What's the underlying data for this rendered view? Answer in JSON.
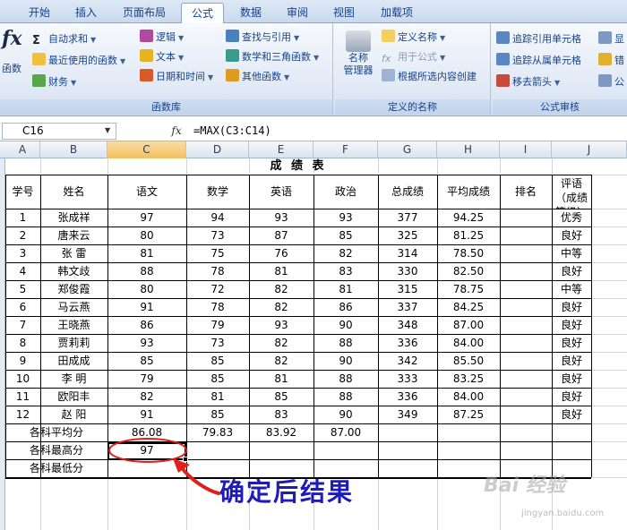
{
  "ribbon": {
    "tabs": [
      "开始",
      "插入",
      "页面布局",
      "公式",
      "数据",
      "审阅",
      "视图",
      "加载项"
    ],
    "active_tab": "公式",
    "function_library": {
      "title": "函数库",
      "insert_function_label": "函数",
      "autosum": "自动求和",
      "recent": "最近使用的函数",
      "financial": "财务",
      "logical": "逻辑",
      "text": "文本",
      "datetime": "日期和时间",
      "lookup": "查找与引用",
      "math": "数学和三角函数",
      "other": "其他函数"
    },
    "defined_names": {
      "title": "定义的名称",
      "name_manager": "名称\n管理器",
      "define_name": "定义名称",
      "use_in_formula": "用于公式",
      "create_from_selection": "根据所选内容创建"
    },
    "auditing": {
      "title": "公式审核",
      "trace_precedents": "追踪引用单元格",
      "trace_dependents": "追踪从属单元格",
      "remove_arrows": "移去箭头",
      "show": "显",
      "error": "错",
      "evaluate": "公"
    }
  },
  "formula_bar": {
    "name_box": "C16",
    "fx_label": "fx",
    "formula": "=MAX(C3:C14)"
  },
  "columns": [
    "A",
    "B",
    "C",
    "D",
    "E",
    "F",
    "G",
    "H",
    "I",
    "J"
  ],
  "selected_column": "C",
  "table": {
    "title": "成 绩 表",
    "headers": [
      "学号",
      "姓名",
      "语文",
      "数学",
      "英语",
      "政治",
      "总成绩",
      "平均成绩",
      "排名",
      "评语（成绩等级）"
    ],
    "rows": [
      [
        "1",
        "张成祥",
        "97",
        "94",
        "93",
        "93",
        "377",
        "94.25",
        "",
        "优秀"
      ],
      [
        "2",
        "唐来云",
        "80",
        "73",
        "87",
        "85",
        "325",
        "81.25",
        "",
        "良好"
      ],
      [
        "3",
        "张  雷",
        "81",
        "75",
        "76",
        "82",
        "314",
        "78.50",
        "",
        "中等"
      ],
      [
        "4",
        "韩文歧",
        "88",
        "78",
        "81",
        "83",
        "330",
        "82.50",
        "",
        "良好"
      ],
      [
        "5",
        "郑俊霞",
        "80",
        "72",
        "82",
        "81",
        "315",
        "78.75",
        "",
        "中等"
      ],
      [
        "6",
        "马云燕",
        "91",
        "78",
        "82",
        "86",
        "337",
        "84.25",
        "",
        "良好"
      ],
      [
        "7",
        "王晓燕",
        "86",
        "79",
        "93",
        "90",
        "348",
        "87.00",
        "",
        "良好"
      ],
      [
        "8",
        "贾莉莉",
        "93",
        "73",
        "82",
        "88",
        "336",
        "84.00",
        "",
        "良好"
      ],
      [
        "9",
        "田成成",
        "85",
        "85",
        "82",
        "90",
        "342",
        "85.50",
        "",
        "良好"
      ],
      [
        "10",
        "李  明",
        "79",
        "85",
        "81",
        "88",
        "333",
        "83.25",
        "",
        "良好"
      ],
      [
        "11",
        "欧阳丰",
        "82",
        "81",
        "85",
        "88",
        "336",
        "84.00",
        "",
        "良好"
      ],
      [
        "12",
        "赵  阳",
        "91",
        "85",
        "83",
        "90",
        "349",
        "87.25",
        "",
        "良好"
      ]
    ],
    "avg_label": "各科平均分",
    "avgs": [
      "86.08",
      "79.83",
      "83.92",
      "87.00"
    ],
    "max_label": "各科最高分",
    "max_chinese": "97",
    "min_label": "各科最低分"
  },
  "annotation": "确定后结果",
  "watermark": "Bai 经验",
  "watermark_url": "jingyan.baidu.com",
  "colors": {
    "annotation": "#1f1bb8",
    "circle": "#e0201a",
    "ribbon_text": "#15428b"
  }
}
